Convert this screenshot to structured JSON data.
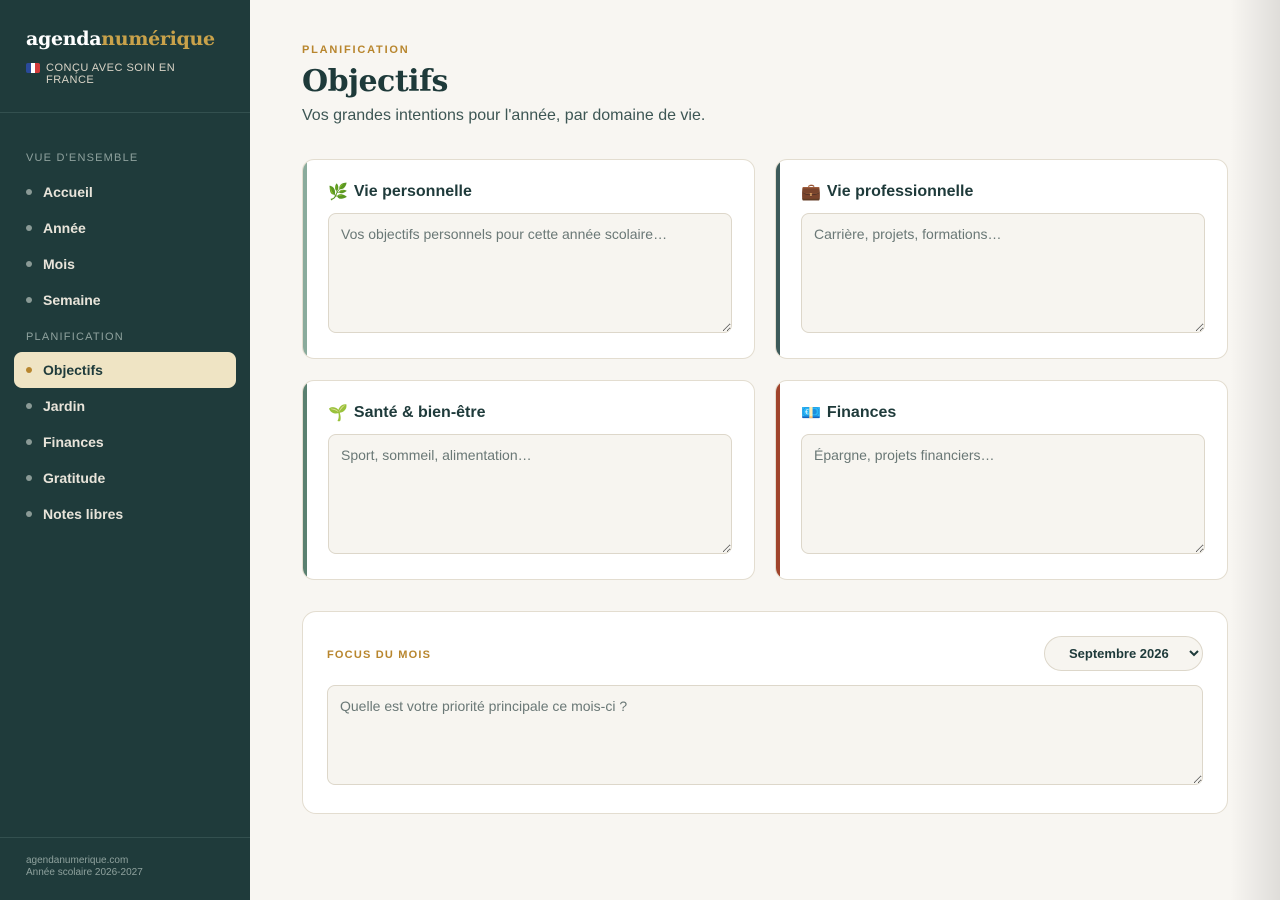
{
  "brand": {
    "name_part1": "agenda",
    "name_part2": "numérique",
    "tagline": "CONÇU AVEC SOIN EN FRANCE"
  },
  "nav": {
    "sections": [
      {
        "title": "VUE D'ENSEMBLE",
        "items": [
          {
            "label": "Accueil"
          },
          {
            "label": "Année"
          },
          {
            "label": "Mois"
          },
          {
            "label": "Semaine"
          }
        ]
      },
      {
        "title": "PLANIFICATION",
        "items": [
          {
            "label": "Objectifs"
          },
          {
            "label": "Jardin"
          },
          {
            "label": "Finances"
          },
          {
            "label": "Gratitude"
          },
          {
            "label": "Notes libres"
          }
        ]
      }
    ],
    "active": "Objectifs"
  },
  "footer": {
    "line1": "agendanumerique.com",
    "line2": "Année scolaire 2026-2027"
  },
  "page": {
    "eyebrow": "PLANIFICATION",
    "title": "Objectifs",
    "subtitle": "Vos grandes intentions pour l'année, par domaine de vie."
  },
  "cards": [
    {
      "icon": "🌿",
      "title": "Vie personnelle",
      "placeholder": "Vos objectifs personnels pour cette année scolaire…",
      "value": "",
      "accent": "#8aab9c"
    },
    {
      "icon": "💼",
      "title": "Vie professionnelle",
      "placeholder": "Carrière, projets, formations…",
      "value": "",
      "accent": "#3d5a5a"
    },
    {
      "icon": "🌱",
      "title": "Santé & bien-être",
      "placeholder": "Sport, sommeil, alimentation…",
      "value": "",
      "accent": "#5a8070"
    },
    {
      "icon": "💶",
      "title": "Finances",
      "placeholder": "Épargne, projets financiers…",
      "value": "",
      "accent": "#a0442c"
    }
  ],
  "focus": {
    "label": "FOCUS DU MOIS",
    "selected_month": "Septembre 2026",
    "placeholder": "Quelle est votre priorité principale ce mois-ci ?",
    "value": ""
  },
  "colors": {
    "sidebar_bg": "#1f3b3b",
    "accent_gold": "#b8862e",
    "active_bg": "#efe4c4",
    "page_bg": "#f8f6f2"
  }
}
